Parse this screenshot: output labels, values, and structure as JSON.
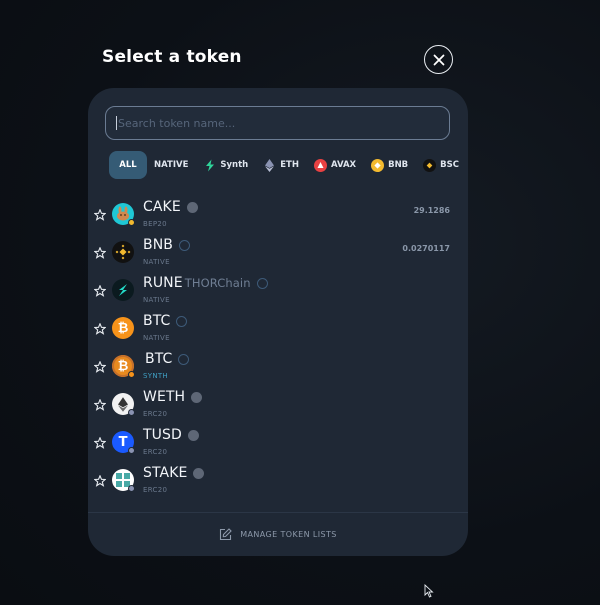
{
  "modal": {
    "title": "Select a token",
    "close_icon": "close-icon"
  },
  "search": {
    "placeholder": "Search token name..."
  },
  "filters": [
    {
      "label": "ALL",
      "icon": "",
      "active": true
    },
    {
      "label": "NATIVE",
      "icon": "",
      "active": false
    },
    {
      "label": "Synth",
      "icon": "synth-bolt-icon",
      "active": false
    },
    {
      "label": "ETH",
      "icon": "ethereum-icon",
      "active": false
    },
    {
      "label": "AVAX",
      "icon": "avalanche-icon",
      "active": false
    },
    {
      "label": "BNB",
      "icon": "bnb-icon",
      "active": false
    },
    {
      "label": "BSC",
      "icon": "bsc-icon",
      "active": false
    }
  ],
  "tokens": [
    {
      "symbol": "CAKE",
      "chain_name": "",
      "sub": "BEP20",
      "balance": "29.1286",
      "icon": "pancakeswap-icon",
      "verify": "bsc-chain-icon"
    },
    {
      "symbol": "BNB",
      "chain_name": "",
      "sub": "NATIVE",
      "balance": "0.0270117",
      "icon": "bnb-icon",
      "verify": "check-icon"
    },
    {
      "symbol": "RUNE",
      "chain_name": "THORChain",
      "sub": "NATIVE",
      "balance": "",
      "icon": "thorchain-icon",
      "verify": "check-icon"
    },
    {
      "symbol": "BTC",
      "chain_name": "",
      "sub": "NATIVE",
      "balance": "",
      "icon": "bitcoin-icon",
      "verify": "check-icon"
    },
    {
      "symbol": "BTC",
      "chain_name": "",
      "sub": "SYNTH",
      "balance": "",
      "icon": "bitcoin-synth-icon",
      "verify": "check-icon"
    },
    {
      "symbol": "WETH",
      "chain_name": "",
      "sub": "ERC20",
      "balance": "",
      "icon": "ethereum-icon",
      "verify": "eth-chain-icon"
    },
    {
      "symbol": "TUSD",
      "chain_name": "",
      "sub": "ERC20",
      "balance": "",
      "icon": "trueusd-icon",
      "verify": "eth-chain-icon"
    },
    {
      "symbol": "STAKE",
      "chain_name": "",
      "sub": "ERC20",
      "balance": "",
      "icon": "xdai-stake-icon",
      "verify": "eth-chain-icon"
    }
  ],
  "footer": {
    "label": "MANAGE TOKEN LISTS",
    "icon": "edit-icon"
  },
  "colors": {
    "background": "#0c1016",
    "panel": "#1f2835",
    "active_filter": "#355b75",
    "synth_text": "#3f9ec2"
  }
}
